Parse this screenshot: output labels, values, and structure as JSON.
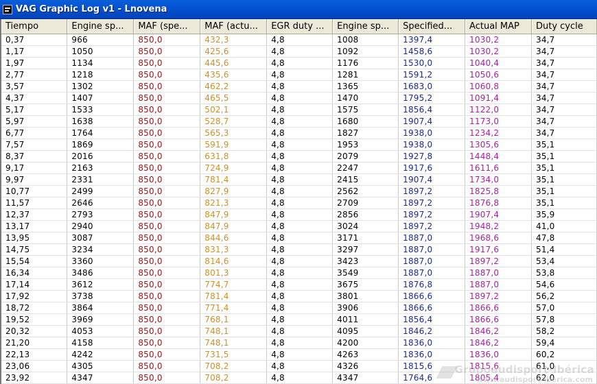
{
  "window": {
    "title": "VAG Graphic Log  v1 -  Lnovena",
    "icon": "app-window-icon"
  },
  "colors": {
    "title_bar": "#0453d4",
    "col_tiempo": "#000000",
    "col_engine_speed": "#000000",
    "col_maf_specified": "#9c1414",
    "col_maf_actual": "#d2901a",
    "col_egr_duty": "#000000",
    "col_engine_speed_2": "#000000",
    "col_specified_map": "#1c2b8a",
    "col_actual_map": "#b01aa6",
    "col_duty_cycle": "#000000"
  },
  "table": {
    "columns": [
      "Tiempo",
      "Engine sp...",
      "MAF (spe...",
      "MAF (actu...",
      "EGR duty ...",
      "Engine sp...",
      "Specified...",
      "Actual MAP",
      "Duty cycle"
    ],
    "rows": [
      [
        "0,37",
        "966",
        "850,0",
        "432,3",
        "4,8",
        "1008",
        "1397,4",
        "1030,2",
        "34,7"
      ],
      [
        "1,17",
        "1050",
        "850,0",
        "425,6",
        "4,8",
        "1092",
        "1458,6",
        "1030,2",
        "34,7"
      ],
      [
        "1,97",
        "1134",
        "850,0",
        "445,6",
        "4,8",
        "1176",
        "1530,0",
        "1040,4",
        "34,7"
      ],
      [
        "2,77",
        "1218",
        "850,0",
        "435,6",
        "4,8",
        "1281",
        "1591,2",
        "1050,6",
        "34,7"
      ],
      [
        "3,57",
        "1302",
        "850,0",
        "462,2",
        "4,8",
        "1365",
        "1683,0",
        "1060,8",
        "34,7"
      ],
      [
        "4,37",
        "1407",
        "850,0",
        "465,5",
        "4,8",
        "1470",
        "1795,2",
        "1091,4",
        "34,7"
      ],
      [
        "5,17",
        "1533",
        "850,0",
        "502,1",
        "4,8",
        "1575",
        "1856,4",
        "1122,0",
        "34,7"
      ],
      [
        "5,97",
        "1638",
        "850,0",
        "528,7",
        "4,8",
        "1680",
        "1907,4",
        "1173,0",
        "34,7"
      ],
      [
        "6,77",
        "1764",
        "850,0",
        "565,3",
        "4,8",
        "1827",
        "1938,0",
        "1234,2",
        "34,7"
      ],
      [
        "7,57",
        "1869",
        "850,0",
        "591,9",
        "4,8",
        "1953",
        "1938,0",
        "1305,6",
        "35,1"
      ],
      [
        "8,37",
        "2016",
        "850,0",
        "631,8",
        "4,8",
        "2079",
        "1927,8",
        "1448,4",
        "35,1"
      ],
      [
        "9,17",
        "2163",
        "850,0",
        "724,9",
        "4,8",
        "2247",
        "1917,6",
        "1611,6",
        "35,1"
      ],
      [
        "9,97",
        "2331",
        "850,0",
        "781,4",
        "4,8",
        "2415",
        "1907,4",
        "1734,0",
        "35,1"
      ],
      [
        "10,77",
        "2499",
        "850,0",
        "827,9",
        "4,8",
        "2562",
        "1897,2",
        "1825,8",
        "35,1"
      ],
      [
        "11,57",
        "2646",
        "850,0",
        "821,3",
        "4,8",
        "2709",
        "1897,2",
        "1876,8",
        "35,1"
      ],
      [
        "12,37",
        "2793",
        "850,0",
        "847,9",
        "4,8",
        "2856",
        "1897,2",
        "1907,4",
        "35,9"
      ],
      [
        "13,17",
        "2940",
        "850,0",
        "847,9",
        "4,8",
        "3024",
        "1897,2",
        "1948,2",
        "41,0"
      ],
      [
        "13,95",
        "3087",
        "850,0",
        "844,6",
        "4,8",
        "3171",
        "1887,0",
        "1968,6",
        "47,8"
      ],
      [
        "14,75",
        "3234",
        "850,0",
        "831,3",
        "4,8",
        "3297",
        "1887,0",
        "1917,6",
        "51,4"
      ],
      [
        "15,54",
        "3360",
        "850,0",
        "814,6",
        "4,8",
        "3423",
        "1887,0",
        "1897,2",
        "53,4"
      ],
      [
        "16,34",
        "3486",
        "850,0",
        "801,3",
        "4,8",
        "3549",
        "1887,0",
        "1887,0",
        "53,8"
      ],
      [
        "17,14",
        "3612",
        "850,0",
        "774,7",
        "4,8",
        "3675",
        "1876,8",
        "1887,0",
        "54,6"
      ],
      [
        "17,92",
        "3738",
        "850,0",
        "781,4",
        "4,8",
        "3801",
        "1866,6",
        "1897,2",
        "56,2"
      ],
      [
        "18,72",
        "3864",
        "850,0",
        "771,4",
        "4,8",
        "3906",
        "1866,6",
        "1866,6",
        "57,0"
      ],
      [
        "19,52",
        "3969",
        "850,0",
        "768,1",
        "4,8",
        "4011",
        "1856,4",
        "1866,6",
        "57,8"
      ],
      [
        "20,32",
        "4053",
        "850,0",
        "748,1",
        "4,8",
        "4095",
        "1846,2",
        "1846,2",
        "58,2"
      ],
      [
        "21,20",
        "4158",
        "850,0",
        "748,1",
        "4,8",
        "4200",
        "1836,0",
        "1846,2",
        "59,4"
      ],
      [
        "22,13",
        "4242",
        "850,0",
        "731,5",
        "4,8",
        "4263",
        "1836,0",
        "1836,0",
        "60,2"
      ],
      [
        "23,06",
        "4305",
        "850,0",
        "708,2",
        "4,8",
        "4326",
        "1815,6",
        "1815,6",
        "61,0"
      ],
      [
        "23,92",
        "4347",
        "850,0",
        "708,2",
        "4,8",
        "4347",
        "1764,6",
        "1805,4",
        "62,0"
      ]
    ]
  },
  "watermark": {
    "line1": "Grupoaudisport-Ibérica",
    "line2": "www.audisport-iberica.com"
  }
}
